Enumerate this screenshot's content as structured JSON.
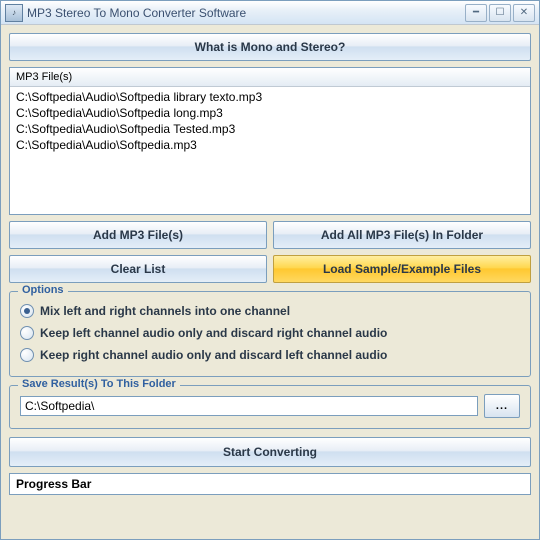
{
  "window": {
    "title": "MP3 Stereo To Mono Converter Software"
  },
  "header_button": "What is Mono and Stereo?",
  "filelist": {
    "header": "MP3 File(s)",
    "items": [
      "C:\\Softpedia\\Audio\\Softpedia library texto.mp3",
      "C:\\Softpedia\\Audio\\Softpedia long.mp3",
      "C:\\Softpedia\\Audio\\Softpedia Tested.mp3",
      "C:\\Softpedia\\Audio\\Softpedia.mp3"
    ]
  },
  "buttons": {
    "add_files": "Add MP3 File(s)",
    "add_folder": "Add All MP3 File(s) In Folder",
    "clear_list": "Clear List",
    "load_sample": "Load Sample/Example Files",
    "browse": "...",
    "start": "Start Converting"
  },
  "options": {
    "title": "Options",
    "items": [
      {
        "label": "Mix left and right channels into one channel",
        "selected": true
      },
      {
        "label": "Keep left channel audio only and discard right channel audio",
        "selected": false
      },
      {
        "label": "Keep right channel audio only and discard left channel audio",
        "selected": false
      }
    ]
  },
  "save_folder": {
    "title": "Save Result(s) To This Folder",
    "path": "C:\\Softpedia\\"
  },
  "progress": {
    "label": "Progress Bar"
  }
}
